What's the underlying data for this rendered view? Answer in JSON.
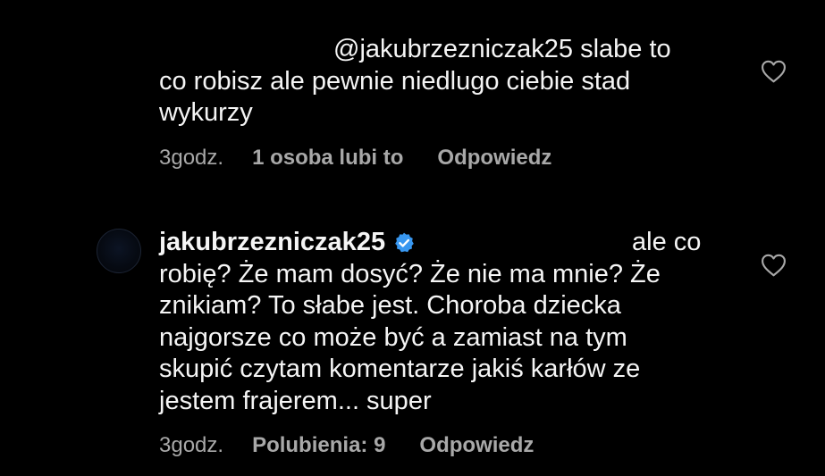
{
  "comment1": {
    "mention_line": "@jakubrzezniczak25 slabe to",
    "line2": "co robisz ale pewnie niedlugo ciebie stad",
    "line3": "wykurzy",
    "time": "3godz.",
    "likes": "1 osoba lubi to",
    "reply": "Odpowiedz",
    "like_icon": "heart-outline-icon"
  },
  "comment2": {
    "username": "jakubrzezniczak25",
    "verified_icon": "verified-badge-icon",
    "lead_text": "ale co",
    "lines": [
      "robię? Że mam dosyć? Że nie ma mnie? Że",
      "znikiam? To słabe jest. Choroba dziecka",
      "najgorsze co może być a zamiast na tym",
      "skupić czytam komentarze jakiś karłów ze",
      "jestem frajerem... super"
    ],
    "time": "3godz.",
    "likes": "Polubienia: 9",
    "reply": "Odpowiedz",
    "like_icon": "heart-outline-icon"
  },
  "colors": {
    "background": "#000000",
    "text": "#f5f5f5",
    "secondary_text": "#a8a8a8",
    "verified_blue": "#3897f0"
  }
}
